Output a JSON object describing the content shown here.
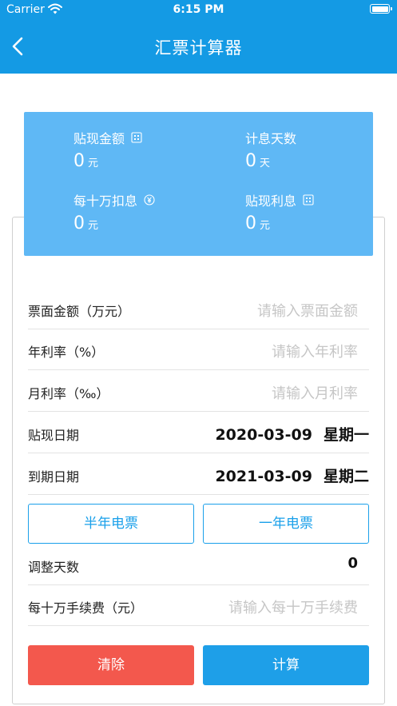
{
  "status_bar": {
    "carrier": "Carrier",
    "time": "6:15 PM"
  },
  "nav": {
    "title": "汇票计算器",
    "back_icon": "chevron-left-icon"
  },
  "summary": {
    "discount_amount": {
      "label": "贴现金额",
      "value": "0",
      "unit": "元",
      "icon": "calculator-icon"
    },
    "interest_days": {
      "label": "计息天数",
      "value": "0",
      "unit": "天"
    },
    "per_100k_deduction": {
      "label": "每十万扣息",
      "value": "0",
      "unit": "元",
      "icon": "yen-coin-icon"
    },
    "discount_interest": {
      "label": "贴现利息",
      "value": "0",
      "unit": "元",
      "icon": "calculator-icon"
    }
  },
  "colors": {
    "header": "#149ae4",
    "summary_bg": "#5fb8f5",
    "clear": "#f3584d",
    "calc": "#1e9fe8",
    "accent": "#1aa0ea"
  },
  "form": {
    "face_amount": {
      "label": "票面金额（万元）",
      "placeholder": "请输入票面金额"
    },
    "annual_rate": {
      "label": "年利率（%）",
      "placeholder": "请输入年利率"
    },
    "monthly_rate": {
      "label": "月利率（‰）",
      "placeholder": "请输入月利率"
    },
    "discount_date": {
      "label": "贴现日期",
      "date": "2020-03-09",
      "weekday": "星期一"
    },
    "due_date": {
      "label": "到期日期",
      "date": "2021-03-09",
      "weekday": "星期二"
    },
    "half_year_button": "半年电票",
    "one_year_button": "一年电票",
    "adjust_days": {
      "label": "调整天数",
      "value": "0"
    },
    "fee_per_100k": {
      "label": "每十万手续费（元）",
      "placeholder": "请输入每十万手续费"
    }
  },
  "actions": {
    "clear": "清除",
    "calculate": "计算"
  }
}
